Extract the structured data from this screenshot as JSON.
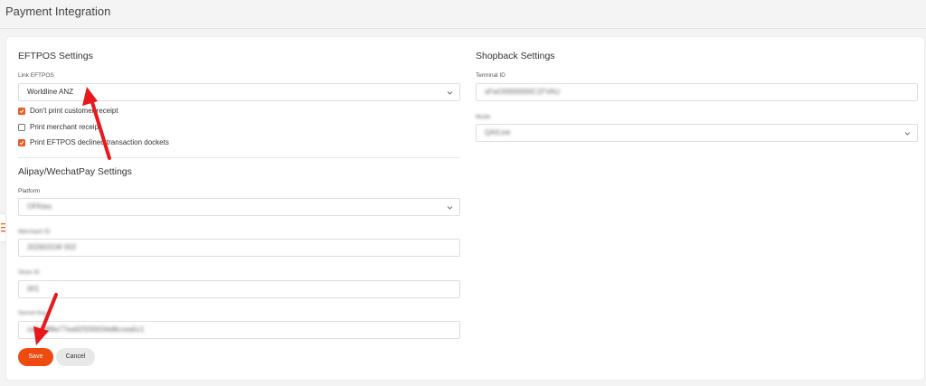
{
  "page": {
    "title": "Payment Integration"
  },
  "eftpos": {
    "section_title": "EFTPOS Settings",
    "link_label": "Link EFTPOS",
    "link_value": "Worldline ANZ",
    "options": [
      {
        "label": "Don't print customer receipt",
        "checked": true
      },
      {
        "label": "Print merchant receipt",
        "checked": false
      },
      {
        "label": "Print EFTPOS declined transaction dockets",
        "checked": true
      }
    ]
  },
  "alipay": {
    "section_title": "Alipay/WechatPay Settings",
    "platform_label": "Platform",
    "platform_value": "OFKtes",
    "merchant_label": "Merchant ID",
    "merchant_value": "2026031W 002",
    "store_label": "Store ID",
    "store_value": "001",
    "secret_label": "Secret Key",
    "secret_value": "ca5dd88e77ea925f30034d8ccea5c1"
  },
  "shopback": {
    "section_title": "Shopback Settings",
    "terminal_label": "Terminal ID",
    "terminal_value": "sFwO0000000C1FVAU",
    "mode_label": "Mode",
    "mode_value": "QA/Live"
  },
  "buttons": {
    "save": "Save",
    "cancel": "Cancel"
  },
  "colors": {
    "accent": "#ef4b10",
    "arrow": "#e8191d"
  }
}
